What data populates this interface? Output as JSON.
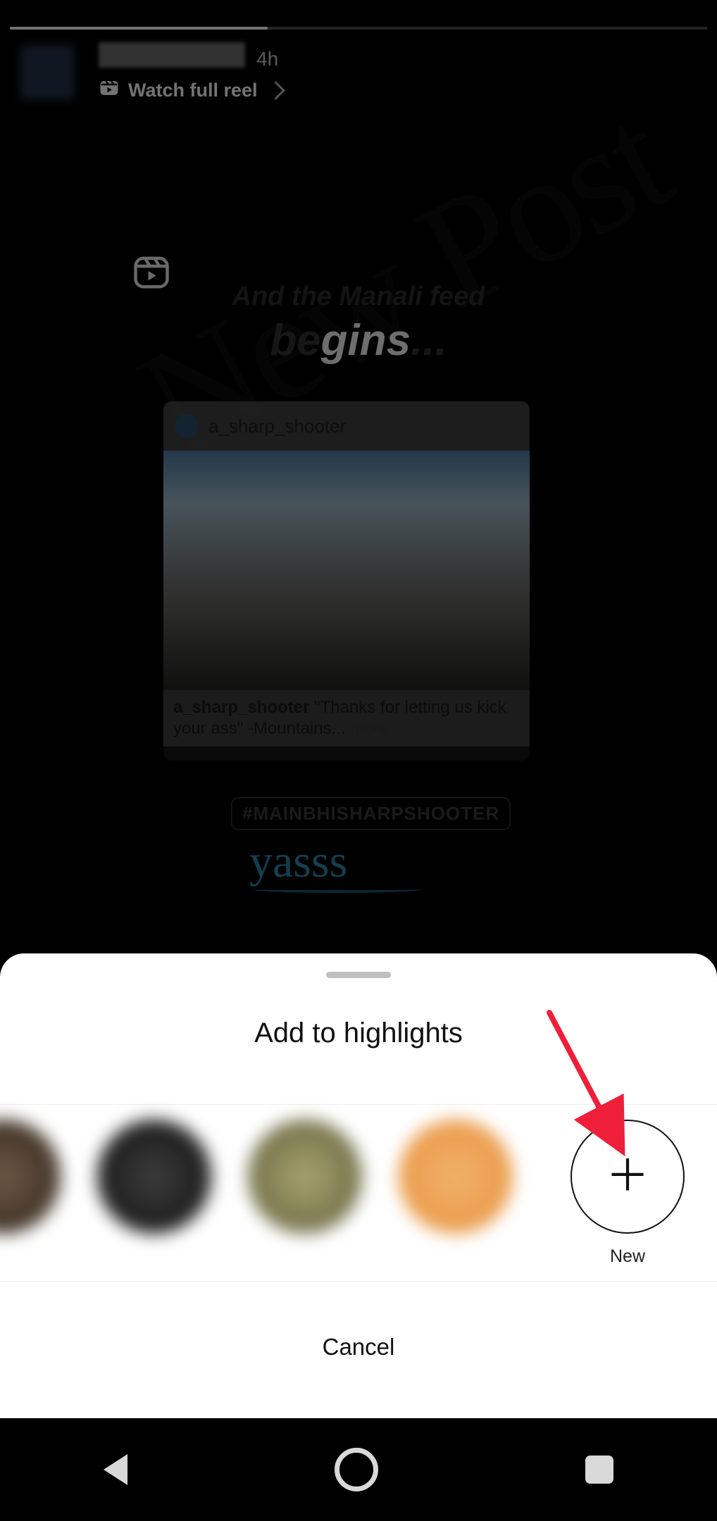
{
  "story": {
    "timestamp": "4h",
    "watch_reel_label": "Watch full reel",
    "headline_line1": "And the Manali feed",
    "headline_pre": "be",
    "headline_lit": "gins",
    "headline_post": "...",
    "sticker_text": "New Post",
    "post_user": "a_sharp_shooter",
    "caption_user": "a_sharp_shooter",
    "caption_text": "\"Thanks for letting us kick your ass\" -Mountains...",
    "caption_more": "more",
    "hashtag": "#MAINBHISHARPSHOOTER",
    "yasss": "yasss"
  },
  "sheet": {
    "title": "Add to highlights",
    "new_label": "New",
    "cancel_label": "Cancel"
  }
}
